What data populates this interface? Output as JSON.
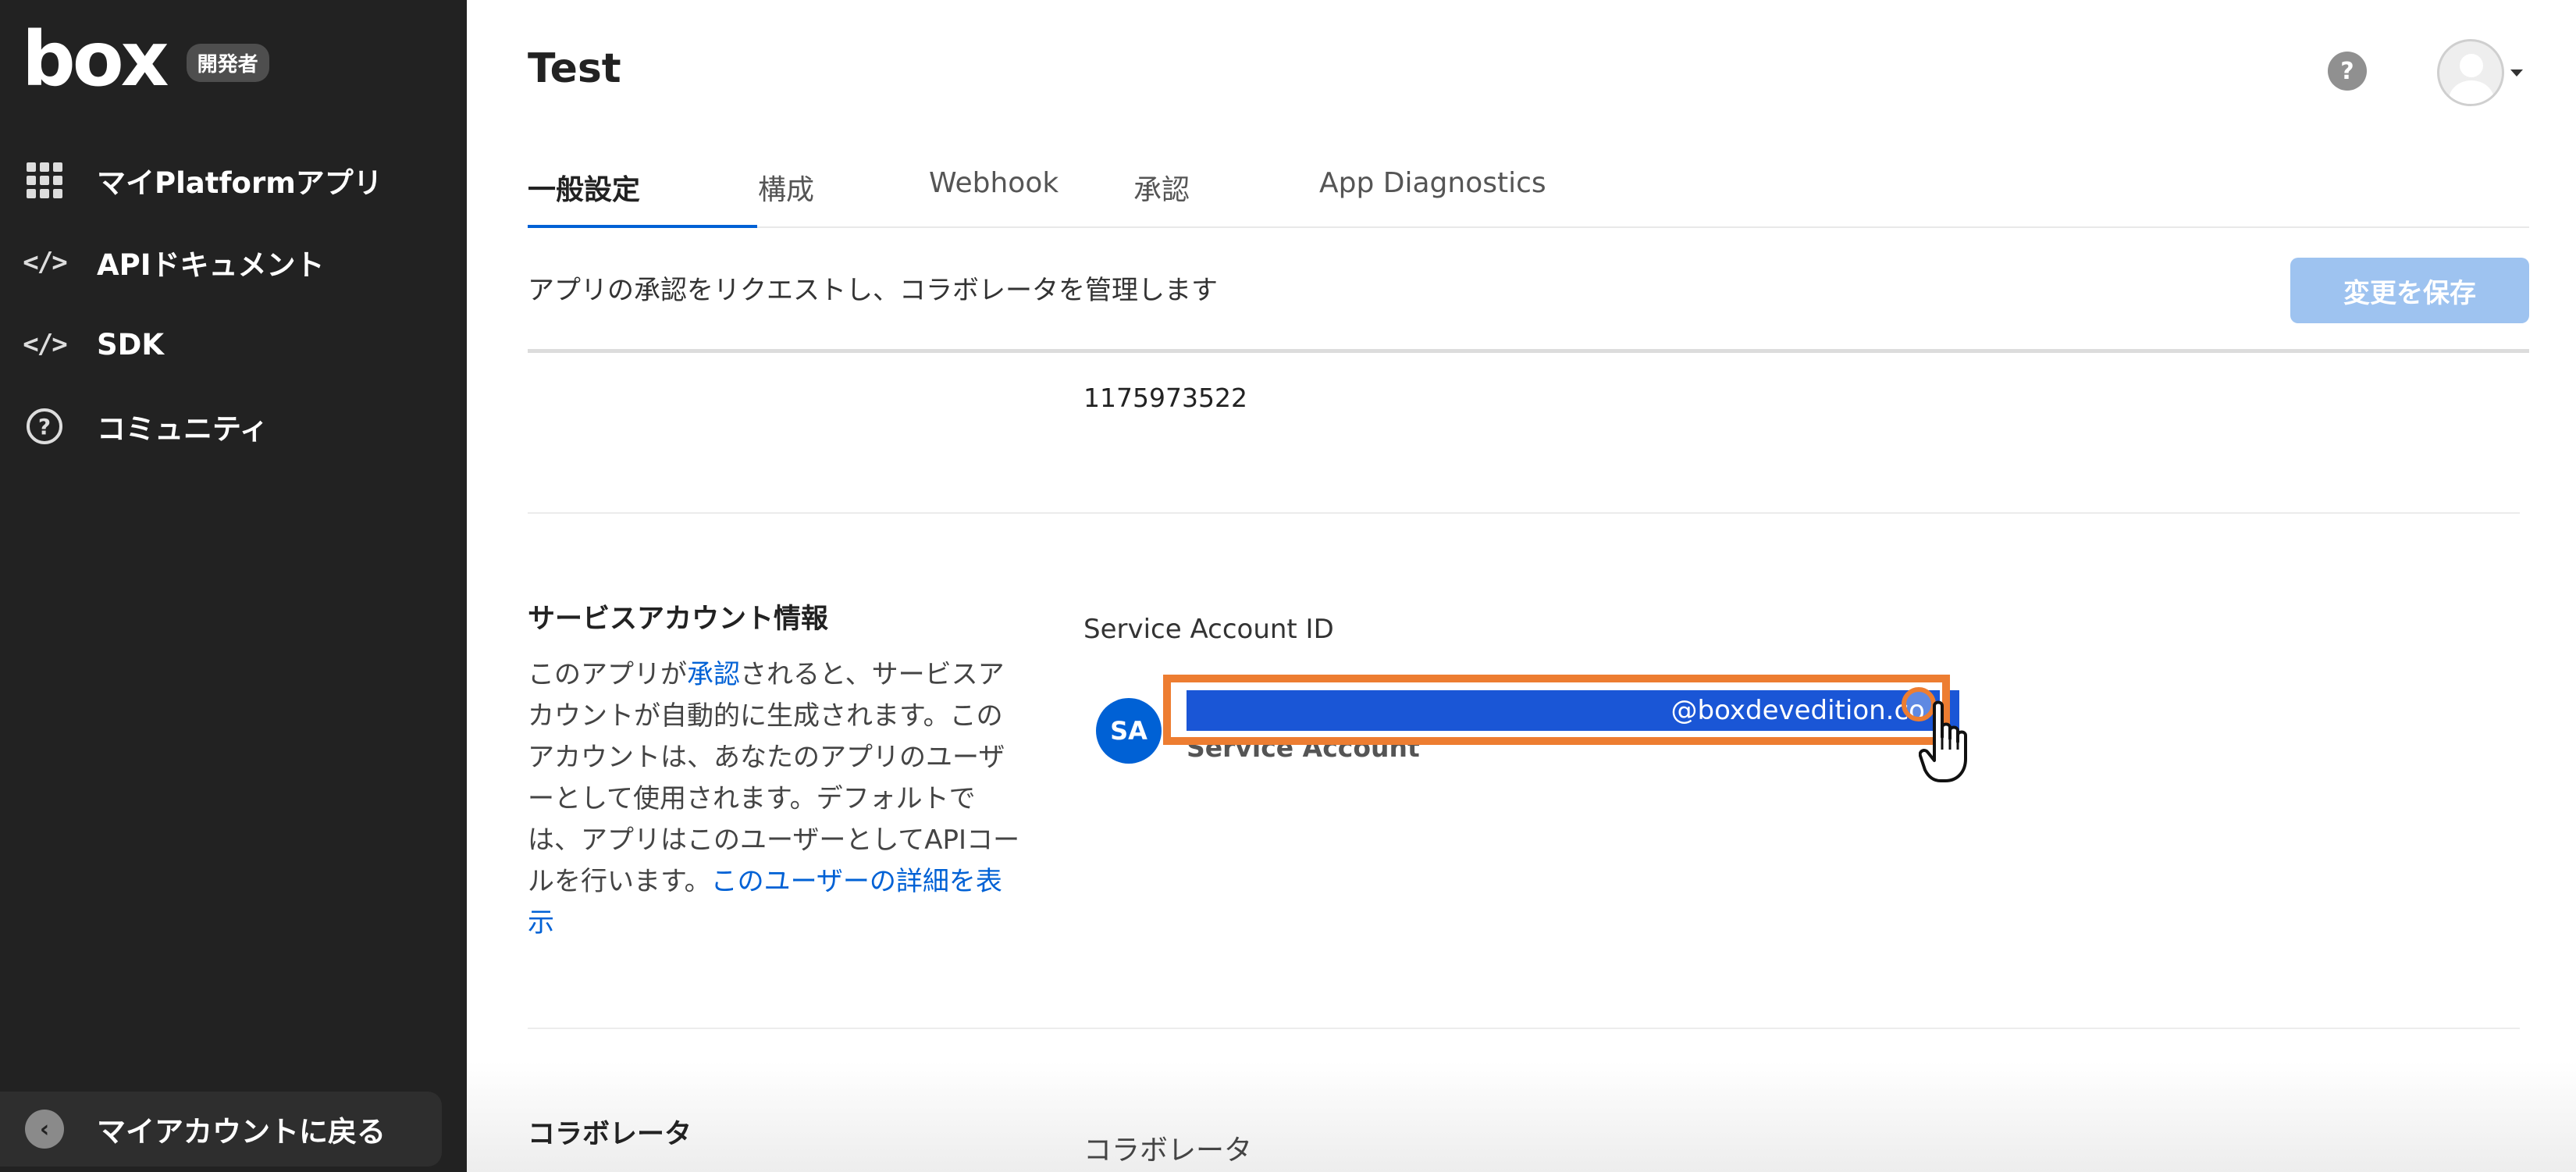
{
  "sidebar": {
    "logo": "box",
    "badge": "開発者",
    "items": [
      {
        "label": "マイPlatformアプリ",
        "icon": "apps-grid-icon"
      },
      {
        "label": "APIドキュメント",
        "icon": "code-icon"
      },
      {
        "label": "SDK",
        "icon": "code-icon"
      },
      {
        "label": "コミュニティ",
        "icon": "question-circle-icon"
      }
    ],
    "back_label": "マイアカウントに戻る",
    "back_icon": "chevron-left-icon",
    "code_glyph": "</>",
    "help_glyph": "?",
    "back_glyph": "‹"
  },
  "header": {
    "title": "Test",
    "help_glyph": "?"
  },
  "tabs": [
    {
      "label": "一般設定",
      "active": true
    },
    {
      "label": "構成",
      "active": false
    },
    {
      "label": "Webhook",
      "active": false
    },
    {
      "label": "承認",
      "active": false
    },
    {
      "label": "App Diagnostics",
      "active": false
    }
  ],
  "subheader": {
    "text": "アプリの承認をリクエストし、コラボレータを管理します",
    "save_label": "変更を保存"
  },
  "enterprise": {
    "id_value": "1175973522"
  },
  "service_account": {
    "heading": "サービスアカウント情報",
    "desc_part1": "このアプリが",
    "desc_link1": "承認",
    "desc_part2": "されると、サービスアカウントが自動的に生成されます。このアカウントは、あなたのアプリのユーザーとして使用されます。デフォルトでは、アプリはこのユーザーとしてAPIコールを行います。",
    "desc_link2": "このユーザーの詳細を表示",
    "id_label": "Service Account ID",
    "avatar_initials": "SA",
    "email_visible": "@boxdevedition.co",
    "subtitle": "Service Account"
  },
  "collaborators": {
    "heading": "コラボレータ",
    "label": "コラボレータ"
  },
  "colors": {
    "sidebar_bg": "#222222",
    "accent": "#0061d5",
    "save_disabled": "#9ec3f0",
    "highlight": "#ed7d31"
  }
}
